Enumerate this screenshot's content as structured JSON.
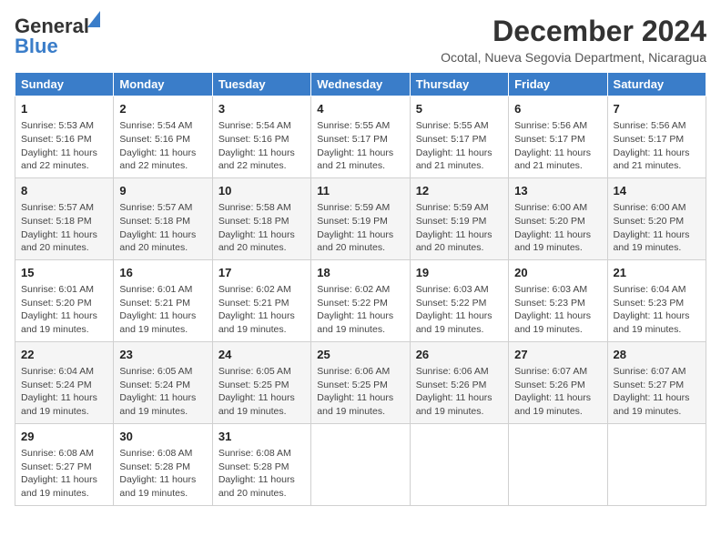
{
  "header": {
    "logo_line1": "General",
    "logo_line2": "Blue",
    "month": "December 2024",
    "location": "Ocotal, Nueva Segovia Department, Nicaragua"
  },
  "weekdays": [
    "Sunday",
    "Monday",
    "Tuesday",
    "Wednesday",
    "Thursday",
    "Friday",
    "Saturday"
  ],
  "weeks": [
    [
      {
        "day": "1",
        "info": "Sunrise: 5:53 AM\nSunset: 5:16 PM\nDaylight: 11 hours\nand 22 minutes."
      },
      {
        "day": "2",
        "info": "Sunrise: 5:54 AM\nSunset: 5:16 PM\nDaylight: 11 hours\nand 22 minutes."
      },
      {
        "day": "3",
        "info": "Sunrise: 5:54 AM\nSunset: 5:16 PM\nDaylight: 11 hours\nand 22 minutes."
      },
      {
        "day": "4",
        "info": "Sunrise: 5:55 AM\nSunset: 5:17 PM\nDaylight: 11 hours\nand 21 minutes."
      },
      {
        "day": "5",
        "info": "Sunrise: 5:55 AM\nSunset: 5:17 PM\nDaylight: 11 hours\nand 21 minutes."
      },
      {
        "day": "6",
        "info": "Sunrise: 5:56 AM\nSunset: 5:17 PM\nDaylight: 11 hours\nand 21 minutes."
      },
      {
        "day": "7",
        "info": "Sunrise: 5:56 AM\nSunset: 5:17 PM\nDaylight: 11 hours\nand 21 minutes."
      }
    ],
    [
      {
        "day": "8",
        "info": "Sunrise: 5:57 AM\nSunset: 5:18 PM\nDaylight: 11 hours\nand 20 minutes."
      },
      {
        "day": "9",
        "info": "Sunrise: 5:57 AM\nSunset: 5:18 PM\nDaylight: 11 hours\nand 20 minutes."
      },
      {
        "day": "10",
        "info": "Sunrise: 5:58 AM\nSunset: 5:18 PM\nDaylight: 11 hours\nand 20 minutes."
      },
      {
        "day": "11",
        "info": "Sunrise: 5:59 AM\nSunset: 5:19 PM\nDaylight: 11 hours\nand 20 minutes."
      },
      {
        "day": "12",
        "info": "Sunrise: 5:59 AM\nSunset: 5:19 PM\nDaylight: 11 hours\nand 20 minutes."
      },
      {
        "day": "13",
        "info": "Sunrise: 6:00 AM\nSunset: 5:20 PM\nDaylight: 11 hours\nand 19 minutes."
      },
      {
        "day": "14",
        "info": "Sunrise: 6:00 AM\nSunset: 5:20 PM\nDaylight: 11 hours\nand 19 minutes."
      }
    ],
    [
      {
        "day": "15",
        "info": "Sunrise: 6:01 AM\nSunset: 5:20 PM\nDaylight: 11 hours\nand 19 minutes."
      },
      {
        "day": "16",
        "info": "Sunrise: 6:01 AM\nSunset: 5:21 PM\nDaylight: 11 hours\nand 19 minutes."
      },
      {
        "day": "17",
        "info": "Sunrise: 6:02 AM\nSunset: 5:21 PM\nDaylight: 11 hours\nand 19 minutes."
      },
      {
        "day": "18",
        "info": "Sunrise: 6:02 AM\nSunset: 5:22 PM\nDaylight: 11 hours\nand 19 minutes."
      },
      {
        "day": "19",
        "info": "Sunrise: 6:03 AM\nSunset: 5:22 PM\nDaylight: 11 hours\nand 19 minutes."
      },
      {
        "day": "20",
        "info": "Sunrise: 6:03 AM\nSunset: 5:23 PM\nDaylight: 11 hours\nand 19 minutes."
      },
      {
        "day": "21",
        "info": "Sunrise: 6:04 AM\nSunset: 5:23 PM\nDaylight: 11 hours\nand 19 minutes."
      }
    ],
    [
      {
        "day": "22",
        "info": "Sunrise: 6:04 AM\nSunset: 5:24 PM\nDaylight: 11 hours\nand 19 minutes."
      },
      {
        "day": "23",
        "info": "Sunrise: 6:05 AM\nSunset: 5:24 PM\nDaylight: 11 hours\nand 19 minutes."
      },
      {
        "day": "24",
        "info": "Sunrise: 6:05 AM\nSunset: 5:25 PM\nDaylight: 11 hours\nand 19 minutes."
      },
      {
        "day": "25",
        "info": "Sunrise: 6:06 AM\nSunset: 5:25 PM\nDaylight: 11 hours\nand 19 minutes."
      },
      {
        "day": "26",
        "info": "Sunrise: 6:06 AM\nSunset: 5:26 PM\nDaylight: 11 hours\nand 19 minutes."
      },
      {
        "day": "27",
        "info": "Sunrise: 6:07 AM\nSunset: 5:26 PM\nDaylight: 11 hours\nand 19 minutes."
      },
      {
        "day": "28",
        "info": "Sunrise: 6:07 AM\nSunset: 5:27 PM\nDaylight: 11 hours\nand 19 minutes."
      }
    ],
    [
      {
        "day": "29",
        "info": "Sunrise: 6:08 AM\nSunset: 5:27 PM\nDaylight: 11 hours\nand 19 minutes."
      },
      {
        "day": "30",
        "info": "Sunrise: 6:08 AM\nSunset: 5:28 PM\nDaylight: 11 hours\nand 19 minutes."
      },
      {
        "day": "31",
        "info": "Sunrise: 6:08 AM\nSunset: 5:28 PM\nDaylight: 11 hours\nand 20 minutes."
      },
      null,
      null,
      null,
      null
    ]
  ]
}
